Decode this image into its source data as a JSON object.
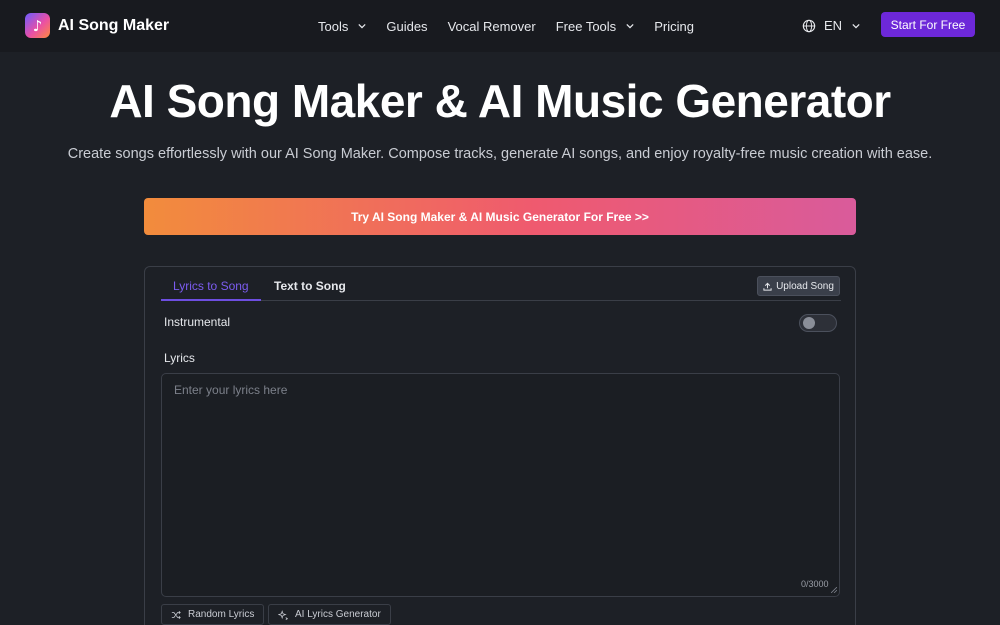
{
  "brand": {
    "name": "AI Song Maker",
    "logo_glyph": "♪",
    "logo_gradient": [
      "#6b5cff",
      "#e94fa6",
      "#ff8a3d"
    ]
  },
  "nav": {
    "items": [
      {
        "label": "Tools",
        "has_dropdown": true
      },
      {
        "label": "Guides",
        "has_dropdown": false
      },
      {
        "label": "Vocal Remover",
        "has_dropdown": false
      },
      {
        "label": "Free Tools",
        "has_dropdown": true
      },
      {
        "label": "Pricing",
        "has_dropdown": false
      }
    ],
    "language": "EN",
    "start_label": "Start For Free"
  },
  "hero": {
    "title": "AI Song Maker & AI Music Generator",
    "subtitle": "Create songs effortlessly with our AI Song Maker. Compose tracks, generate AI songs, and enjoy royalty-free music creation with ease.",
    "cta_label": "Try AI Song Maker & AI Music Generator For Free >>"
  },
  "panel": {
    "tabs": [
      {
        "label": "Lyrics to Song",
        "active": true
      },
      {
        "label": "Text to Song",
        "active": false
      }
    ],
    "upload_label": "Upload Song",
    "instrumental_label": "Instrumental",
    "instrumental_on": false,
    "lyrics_label": "Lyrics",
    "lyrics_placeholder": "Enter your lyrics here",
    "lyrics_value": "",
    "counter": "0/3000",
    "random_label": "Random Lyrics",
    "ai_lyrics_label": "AI Lyrics Generator"
  },
  "colors": {
    "background": "#1d2026",
    "header": "#181a1f",
    "accent": "#6d28d9",
    "active_tab": "#7c5cf0",
    "cta_gradient": [
      "#f28c3c",
      "#ef5a6f",
      "#d95b9b"
    ]
  }
}
